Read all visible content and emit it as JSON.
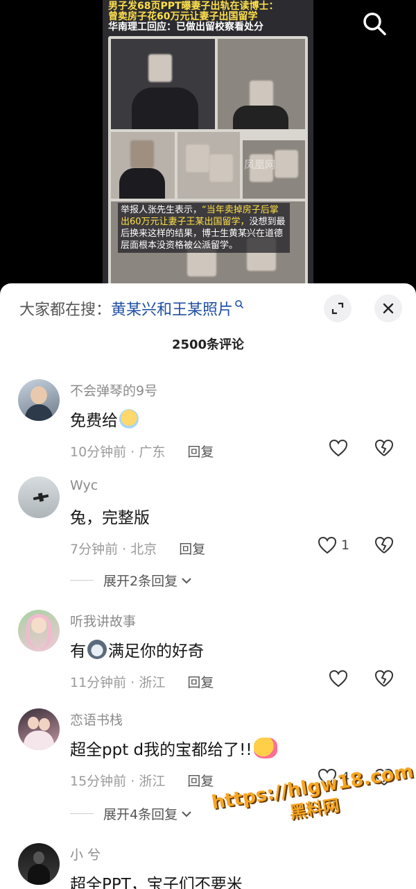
{
  "video": {
    "headline_line1": "男子发68页PPT曝妻子出轨在读博士：",
    "headline_line2": "曾卖房子花60万元让妻子出国留学",
    "headline_line3": "华南理工回应：已做出留校察看处分",
    "source_watermark": "凤凰网",
    "caption_part1": "举报人张先生表示，",
    "caption_highlight": "“当年卖掉房子后掌出60万元让妻子王某出国留学，",
    "caption_part2": "没想到最后换来这样的结果，博士生黄某兴在道德层面根本没资格被公派留学。"
  },
  "search_icon": "search-icon",
  "sheet": {
    "search_prefix": "大家都在搜：",
    "search_term": "黄某兴和王某照片",
    "comment_count": "2500条评论"
  },
  "comments": [
    {
      "user": "不会弹琴的9号",
      "text": "免费给",
      "time": "10分钟前",
      "location": "广东",
      "reply": "回复",
      "likes": ""
    },
    {
      "user": "Wyc",
      "text": "兔，完整版",
      "time": "7分钟前",
      "location": "北京",
      "reply": "回复",
      "likes": "1",
      "expand": "展开2条回复"
    },
    {
      "user": "听我讲故事",
      "text_a": "有",
      "text_b": "满足你的好奇",
      "time": "11分钟前",
      "location": "浙江",
      "reply": "回复",
      "likes": ""
    },
    {
      "user": "恋语书栈",
      "text": "超全ppt  d我的宝都给了!! ",
      "time": "15分钟前",
      "location": "浙江",
      "reply": "回复",
      "likes": "4",
      "expand": "展开4条回复"
    },
    {
      "user": "小 兮",
      "text": "超全PPT，宝子们不要米"
    }
  ],
  "meta_sep": " · ",
  "site_watermark": {
    "line1": "https://hlgw18.com",
    "line2": "黑料网"
  },
  "colors": {
    "accent_link": "#1f4fa3",
    "watermark_orange": "#f5a623",
    "highlight_yellow": "#ffe14a"
  }
}
